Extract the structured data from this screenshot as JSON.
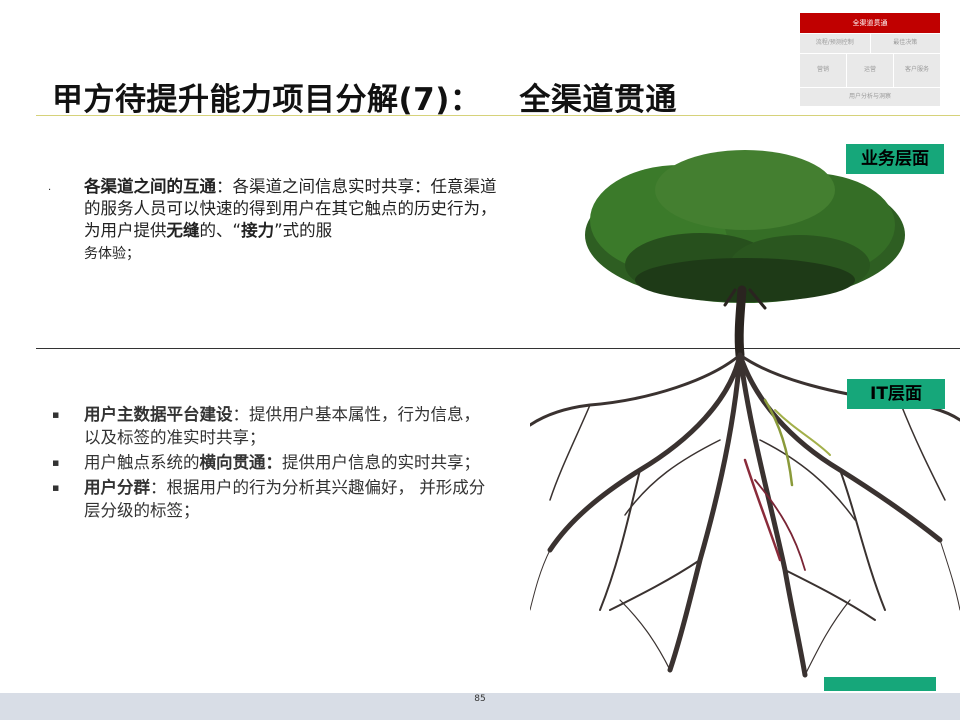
{
  "nav": {
    "header": "全渠道贯通",
    "row1": [
      "流程/预测控制",
      "最佳决策"
    ],
    "row2": [
      "营销",
      "运营",
      "客户服务"
    ],
    "row3": "用户分析与洞察",
    "colors": {
      "header": "#c00000",
      "cell": "#e9e9e9"
    }
  },
  "title": {
    "main": "甲方待提升能力项目分解(7)：",
    "sub": "全渠道贯通"
  },
  "business": {
    "bullet": "·",
    "term": "各渠道之间的互通",
    "text1": "：各渠道之间信息实时共享：任意渠道的服务人员可以快速的得到用户在其它触点的历史行为，为用户提供",
    "bold1": "无缝",
    "text2": "的、“",
    "bold2": "接力",
    "text3": "”式的服",
    "tail": "务体验；"
  },
  "it": {
    "bullet": "▪",
    "items": [
      {
        "pre": "",
        "bold": "用户主数据平台建设",
        "post": "：提供用户基本属性，行为信息，以及标签的准实时共享；"
      },
      {
        "pre": "用户触点系统的",
        "bold": "横向贯通：",
        "post": "提供用户信息的实时共享；"
      },
      {
        "pre": "",
        "bold": "用户分群",
        "post": "：根据用户的行为分析其兴趣偏好， 并形成分层分级的标签；"
      }
    ]
  },
  "tags": {
    "business": "业务层面",
    "it": "IT层面",
    "color": "#16a77a"
  },
  "page_number": "85"
}
